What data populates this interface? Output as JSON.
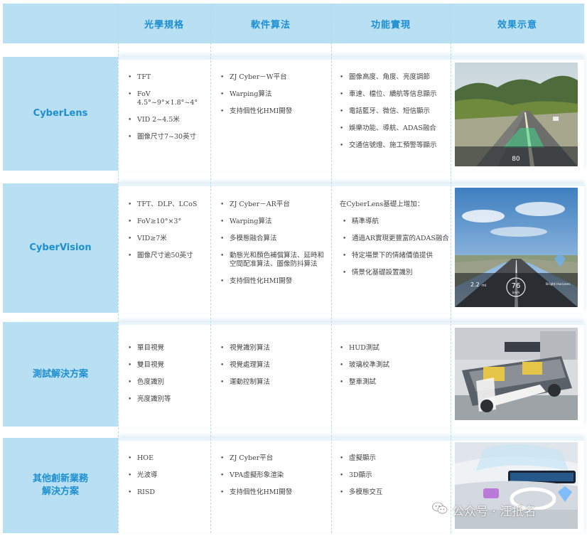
{
  "header": {
    "columns": [
      "光學規格",
      "軟件算法",
      "功能實現",
      "效果示意"
    ]
  },
  "rows": [
    {
      "label": "CyberLens",
      "optical": [
        "TFT",
        "FoV 4.5°~9°×1.8°~4°",
        "VID 2~4.5米",
        "圖像尺寸7~30英寸"
      ],
      "software": [
        "ZJ Cyber－W平台",
        "Warping算法",
        "支持個性化HMI開發"
      ],
      "functions_intro": "",
      "functions": [
        "圖像高度、角度、亮度調節",
        "車速、檔位、續航等信息顯示",
        "電話藍牙、微信、短信顯示",
        "娛樂功能、導航、ADAS融合",
        "交通信號燈、施工預警等顯示"
      ],
      "image": {
        "icon": "hud-road-image",
        "speed": "80"
      }
    },
    {
      "label": "CyberVision",
      "optical": [
        "TFT、DLP、LCoS",
        "FoV≥10°×3°",
        "VID≥7米",
        "圖像尺寸逾50英寸"
      ],
      "software": [
        "ZJ Cyber－AR平台",
        "Warping算法",
        "多模態融合算法",
        "動態光和顏色補償算法、延時和空間配准算法、圖像防抖算法",
        "支持個性化HMI開發"
      ],
      "functions_intro": "在CyberLens基礎上增加：",
      "functions": [
        "精準導航",
        "通過AR實現更豐富的ADAS融合",
        "特定場景下的情緒價值提供",
        "情景化基礎設置識別"
      ],
      "image": {
        "icon": "ar-hud-image",
        "speed": "76",
        "speed_unit": "km/h",
        "distance": "2.2",
        "distance_unit": "mi",
        "music": "Bright Horizons"
      }
    },
    {
      "label": "測試解決方案",
      "optical": [
        "單目視覺",
        "雙目視覺",
        "色度識別",
        "亮度識別等"
      ],
      "software": [
        "視覺識別算法",
        "視覺處理算法",
        "運動控制算法"
      ],
      "functions_intro": "",
      "functions": [
        "HUD測試",
        "玻璃校準測試",
        "整車測試"
      ],
      "image": {
        "icon": "test-rig-image"
      }
    },
    {
      "label": "其他創新業務\n解決方案",
      "optical": [
        "HOE",
        "光波導",
        "RISD"
      ],
      "software": [
        "ZJ Cyber平台",
        "VPA虛擬形象渲染",
        "支持個性化HMI開發"
      ],
      "functions_intro": "",
      "functions": [
        "虛擬顯示",
        "3D顯示",
        "多模態交互"
      ],
      "image": {
        "icon": "cockpit-image"
      }
    }
  ],
  "watermark": {
    "text": "公众号 · 汪抵名",
    "icon": "wechat-icon"
  },
  "colors": {
    "band": "#b8dff2",
    "accent": "#1d8fd1",
    "divider": "#b8d9ea"
  }
}
